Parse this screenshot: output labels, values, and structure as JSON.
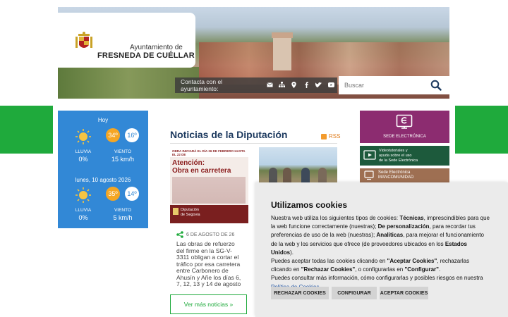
{
  "header": {
    "logo_line1": "Ayuntamiento de",
    "logo_line2": "FRESNEDA DE CUÉLLAR",
    "contact_label": "Contacta con el ayuntamiento:",
    "contact_icons": [
      "mail-icon",
      "sitemap-icon",
      "location-icon",
      "facebook-icon",
      "twitter-icon",
      "youtube-icon"
    ],
    "search_placeholder": "Buscar"
  },
  "weather": {
    "today": {
      "label": "Hoy",
      "max": "34º",
      "min": "16º",
      "rain_label": "LLUVIA",
      "rain_value": "0%",
      "wind_label": "VIENTO",
      "wind_value": "15 km/h"
    },
    "tomorrow": {
      "label": "lunes, 10 agosto 2026",
      "max": "35º",
      "min": "14º",
      "rain_label": "LLUVIA",
      "rain_value": "0%",
      "wind_label": "VIENTO",
      "wind_value": "5 km/h"
    }
  },
  "news": {
    "title": "Noticias de la Diputación",
    "rss_label": "RSS",
    "card1": {
      "img_top": "OBRA INICIARÁ EL DÍA 26 DE FEBRERO HASTA EL 22 DE",
      "img_heading_1": "Atención:",
      "img_heading_2": "Obra en carretera",
      "img_logo_1": "Diputación",
      "img_logo_2": "de Segovia",
      "date": "6 DE AGOSTO DE 26",
      "text": "Las obras de refuerzo del firme en la SG-V-3311 obligan a cortar el tráfico por esa carretera entre Carbonero de Ahusín y Añe los días 6, 7, 12, 13 y 14 de agosto"
    },
    "more_label": "Ver más noticias »"
  },
  "sidebar": {
    "sede_label": "SEDE ELECTRÓNICA",
    "video_line1": "Videotutoriales y",
    "video_line2": "ayuda sobre el uso",
    "video_line3": "de la Sede Electrónica",
    "manc_line1": "Sede Electrónica",
    "manc_line2": "MANCOMUNIDAD"
  },
  "cookies": {
    "title": "Utilizamos cookies",
    "p1_a": "Nuestra web utiliza los siguientes tipos de cookies: ",
    "p1_b": "Técnicas",
    "p1_c": ", imprescindibles para que la web funcione correctamente (nuestras); ",
    "p1_d": "De personalización",
    "p1_e": ", para recordar tus preferencias de uso de la web (nuestras); ",
    "p1_f": "Analíticas",
    "p1_g": ", para mejorar el funcionamiento de la web y los servicios que ofrece (de proveedores ubicados en los ",
    "p1_h": "Estados Unidos",
    "p1_i": ").",
    "p2_a": "Puedes aceptar todas las cookies clicando en ",
    "p2_b": "\"Aceptar Cookies\"",
    "p2_c": ", rechazarlas clicando en ",
    "p2_d": "\"Rechazar Cookies\"",
    "p2_e": ", o configurarlas en ",
    "p2_f": "\"Configurar\"",
    "p2_g": ".",
    "p3": "Puedes consultar más información, cómo configurarlas y posibles riesgos en nuestra ",
    "policy_link": "Política de Cookies",
    "p3_end": ".",
    "reject_label": "RECHAZAR COOKIES",
    "config_label": "CONFIGURAR",
    "accept_label": "ACEPTAR COOKIES"
  },
  "colors": {
    "green": "#1faa3c",
    "weather_blue": "#3288d6",
    "news_title": "#1d3a5f",
    "sede_purple": "#8c2c70",
    "video_green": "#1d5a3c",
    "temp_orange": "#f5a623"
  }
}
